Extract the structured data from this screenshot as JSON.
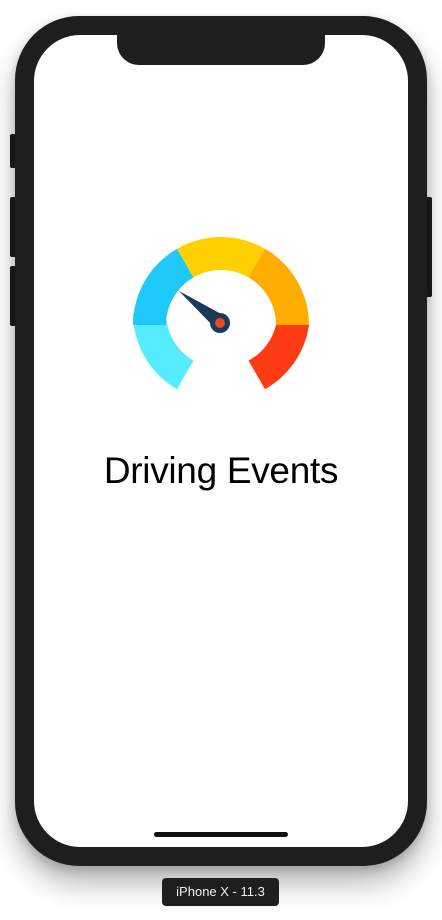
{
  "app": {
    "title": "Driving Events",
    "logo": "speedometer-icon"
  },
  "simulator": {
    "device_label": "iPhone X - 11.3"
  },
  "colors": {
    "device_frame": "#1e1e1e",
    "screen_background": "#ffffff",
    "gauge_cyan_light": "#55ecff",
    "gauge_cyan": "#1ec8f7",
    "gauge_yellow": "#ffd000",
    "gauge_orange": "#ffac00",
    "gauge_red": "#fe3c14",
    "needle": "#1b3a5c",
    "needle_hub": "#ee4a26"
  }
}
